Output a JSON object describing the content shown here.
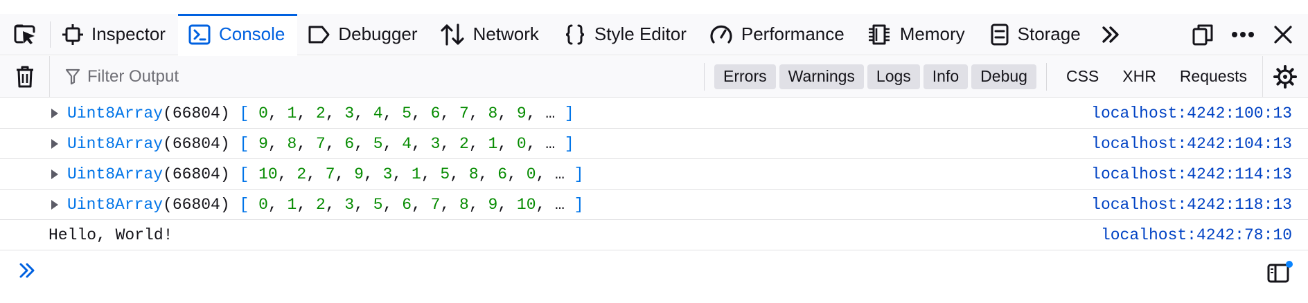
{
  "tabs": [
    {
      "label": "Inspector",
      "icon": "inspector-icon"
    },
    {
      "label": "Console",
      "icon": "console-icon",
      "active": true
    },
    {
      "label": "Debugger",
      "icon": "debugger-icon"
    },
    {
      "label": "Network",
      "icon": "network-icon"
    },
    {
      "label": "Style Editor",
      "icon": "style-editor-icon"
    },
    {
      "label": "Performance",
      "icon": "performance-icon"
    },
    {
      "label": "Memory",
      "icon": "memory-icon"
    },
    {
      "label": "Storage",
      "icon": "storage-icon"
    }
  ],
  "toolbar": {
    "filter_placeholder": "Filter Output",
    "levels": [
      "Errors",
      "Warnings",
      "Logs",
      "Info",
      "Debug"
    ],
    "types": [
      "CSS",
      "XHR",
      "Requests"
    ]
  },
  "messages": [
    {
      "type": "Uint8Array",
      "length": "66804",
      "items": [
        "0",
        "1",
        "2",
        "3",
        "4",
        "5",
        "6",
        "7",
        "8",
        "9"
      ],
      "location": "localhost:4242:100:13"
    },
    {
      "type": "Uint8Array",
      "length": "66804",
      "items": [
        "9",
        "8",
        "7",
        "6",
        "5",
        "4",
        "3",
        "2",
        "1",
        "0"
      ],
      "location": "localhost:4242:104:13"
    },
    {
      "type": "Uint8Array",
      "length": "66804",
      "items": [
        "10",
        "2",
        "7",
        "9",
        "3",
        "1",
        "5",
        "8",
        "6",
        "0"
      ],
      "location": "localhost:4242:114:13"
    },
    {
      "type": "Uint8Array",
      "length": "66804",
      "items": [
        "0",
        "1",
        "2",
        "3",
        "5",
        "6",
        "7",
        "8",
        "9",
        "10"
      ],
      "location": "localhost:4242:118:13"
    }
  ],
  "log_text": {
    "text": "Hello, World!",
    "location": "localhost:4242:78:10"
  },
  "colors": {
    "accent": "#0061e0",
    "number": "#058b00",
    "object": "#0074e8",
    "location": "#0042c4"
  }
}
